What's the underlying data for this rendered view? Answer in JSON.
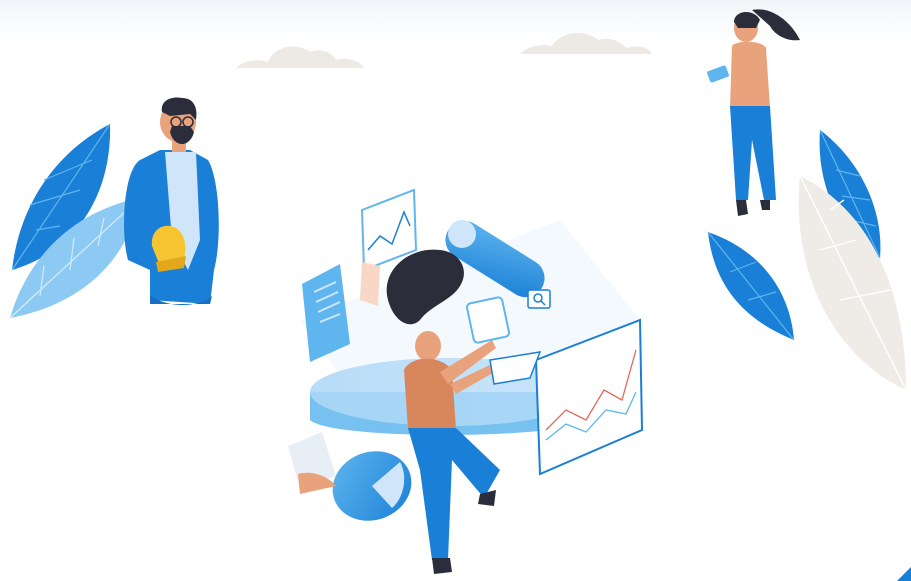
{
  "illustration": {
    "subject": "people-working-with-data",
    "icons": [
      "cloud-icon",
      "leaf-icon",
      "hard-hat-icon",
      "tablet-icon",
      "search-icon",
      "line-chart-icon",
      "pie-chart-icon",
      "document-icon",
      "toggle-icon"
    ]
  },
  "colors": {
    "primary_blue": "#1a7fd6",
    "light_blue": "#5fb6ee",
    "pale_blue": "#cfe6fa",
    "cloud": "#ede9e4",
    "hair": "#2b2d3a",
    "skin": "#e8a27c",
    "shirt": "#d8875c",
    "hat_yellow": "#f6c431",
    "leaf_beige": "#efece7"
  }
}
